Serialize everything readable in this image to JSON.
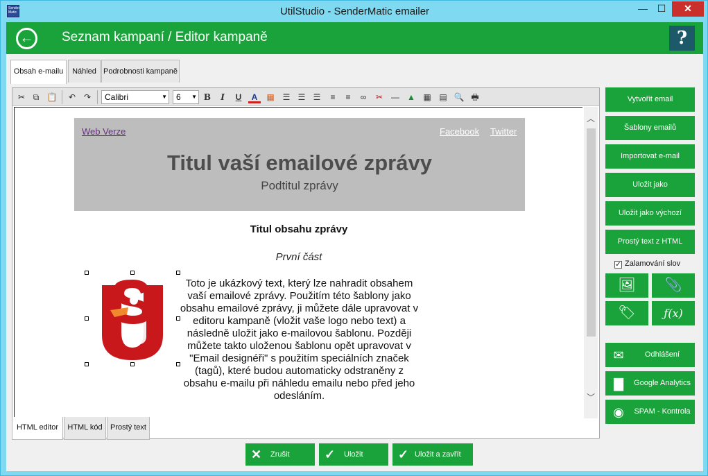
{
  "window": {
    "title": "UtilStudio - SenderMatic emailer",
    "app_icon_text": "Sender Matic",
    "minimize_glyph": "—",
    "maximize_glyph": "☐",
    "close_glyph": "✕"
  },
  "header": {
    "breadcrumb": "Seznam kampaní  / Editor kampaně",
    "help_label": "?",
    "back_icon": "arrow-left-icon",
    "background": "#1aa33a"
  },
  "top_tabs": [
    "Obsah e-mailu",
    "Náhled",
    "Podrobnosti kampaně"
  ],
  "toolbar": {
    "font": "Calibri",
    "size": "6",
    "bold": "B",
    "italic": "I",
    "underline": "U",
    "font_color": "A"
  },
  "email": {
    "web_link": "Web Verze",
    "facebook_link": "Facebook",
    "twitter_link": "Twitter",
    "title": "Titul vaší emailové zprávy",
    "subtitle": "Podtitul zprávy",
    "content_title": "Titul obsahu zprávy",
    "section_title": "První část",
    "body": "Toto je ukázkový text, který lze nahradit obsahem vaší emailové zprávy. Použitím této šablony jako obsahu emailové zprávy, ji můžete dále upravovat v editoru kampaně (vložit vaše logo nebo text) a následně uložit jako e-mailovou šablonu. Později můžete takto uloženou šablonu opět upravovat v \"Email designéři\" s použitím speciálních značek (tagů), které budou automaticky odstraněny z obsahu e-mailu při náhledu emailu nebo před jeho odesláním.",
    "header_background": "#bdbdbd",
    "logo_colors": {
      "red": "#c8181c",
      "orange": "#f08a2c"
    }
  },
  "bottom_tabs": [
    "HTML editor",
    "HTML kód",
    "Prostý text"
  ],
  "sidebar": {
    "buttons": [
      "Vytvořit email",
      "Šablony emailů",
      "Importovat e-mail",
      "Uložit jako",
      "Uložit jako výchozí",
      "Prostý text z HTML"
    ],
    "wrap_label": "Zalamování slov",
    "wrap_checked": true,
    "icon_buttons": [
      {
        "name": "insert-image-icon",
        "glyph": "🖼"
      },
      {
        "name": "attachment-icon",
        "glyph": "📎"
      },
      {
        "name": "insert-tag-icon",
        "glyph": "🏷"
      },
      {
        "name": "function-icon",
        "glyph": "ƒ(x)"
      }
    ],
    "action_buttons": [
      {
        "label": "Odhlášení",
        "icon": "unsubscribe-icon",
        "glyph": "✉"
      },
      {
        "label": "Google Analytics",
        "icon": "bar-chart-icon",
        "glyph": "▇"
      },
      {
        "label": "SPAM - Kontrola",
        "icon": "spam-icon",
        "glyph": "◉"
      }
    ]
  },
  "footer": {
    "cancel": "Zrušit",
    "save": "Uložit",
    "save_close": "Uložit a zavřít",
    "cancel_glyph": "✕",
    "ok_glyph": "✓"
  }
}
